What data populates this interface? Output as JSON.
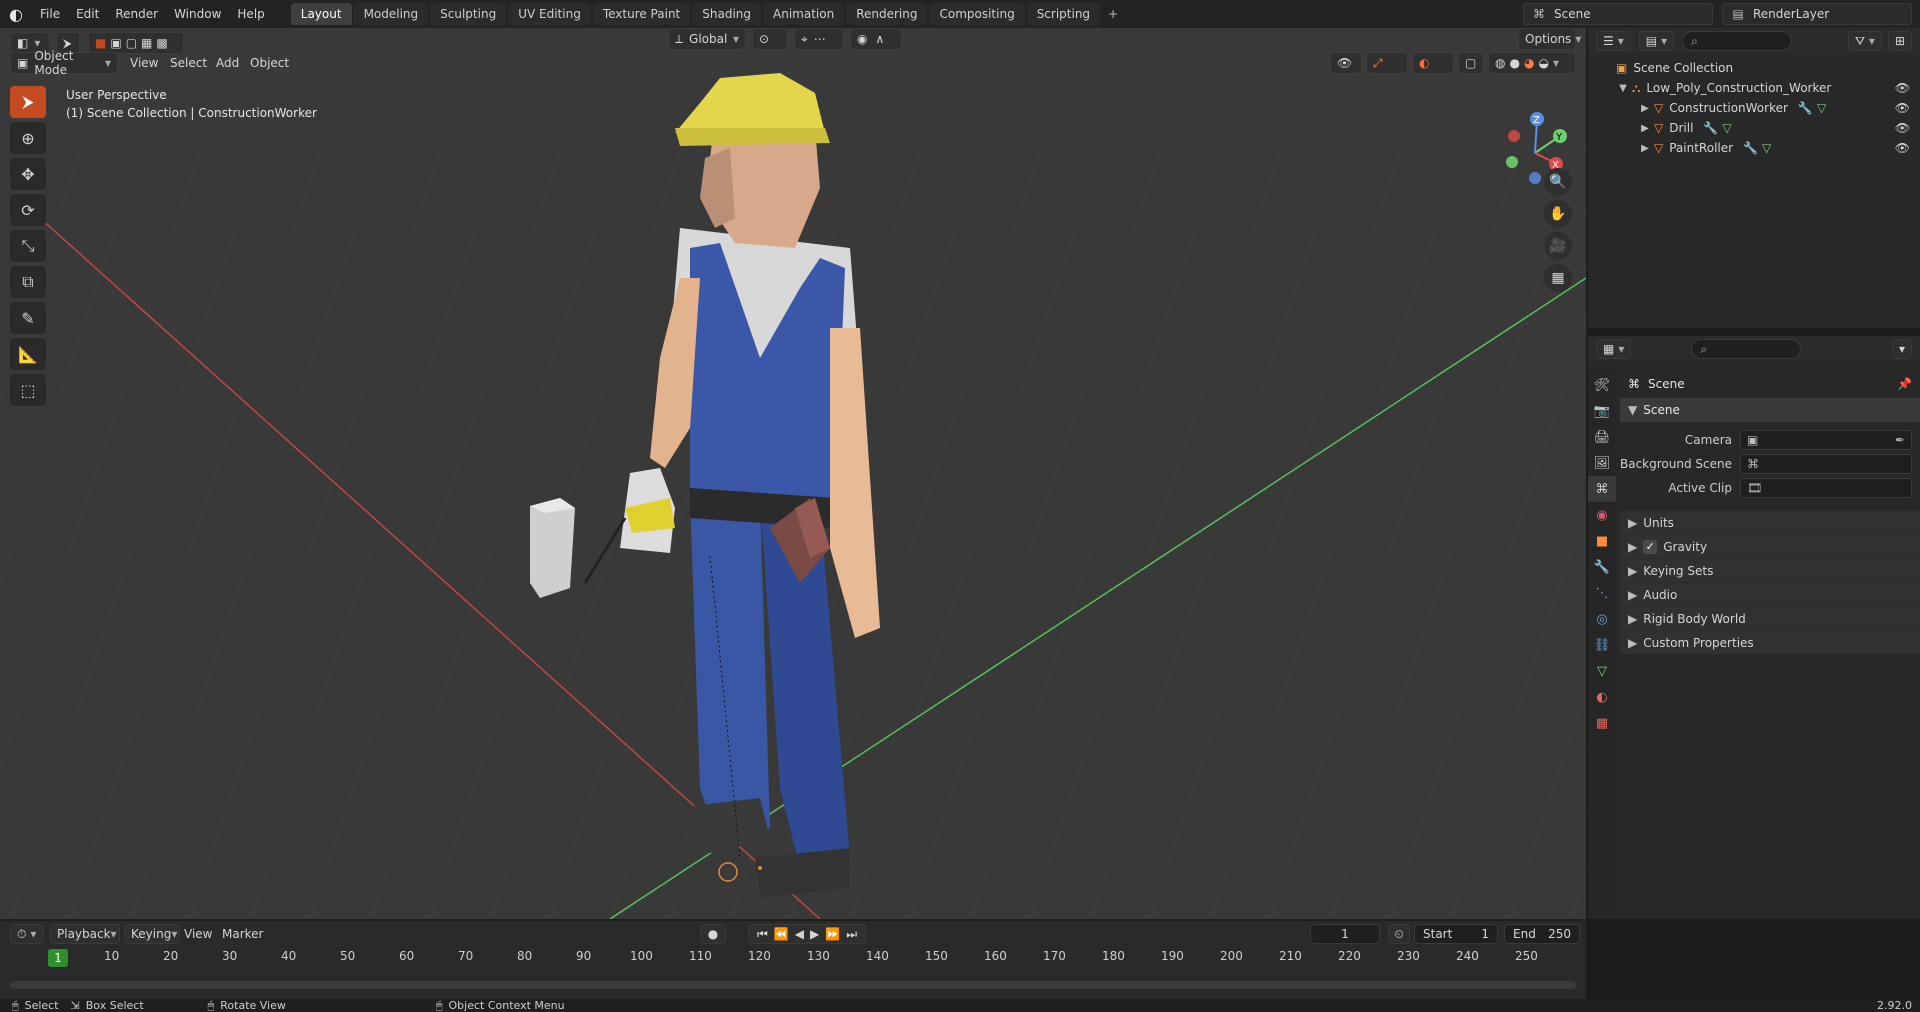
{
  "top_menu": [
    "File",
    "Edit",
    "Render",
    "Window",
    "Help"
  ],
  "workspace_tabs": [
    "Layout",
    "Modeling",
    "Sculpting",
    "UV Editing",
    "Texture Paint",
    "Shading",
    "Animation",
    "Rendering",
    "Compositing",
    "Scripting"
  ],
  "active_tab": "Layout",
  "tab_add": "+",
  "scene_selector": {
    "name": "Scene"
  },
  "view_layer": {
    "name": "RenderLayer"
  },
  "viewport": {
    "mode": "Object Mode",
    "menus": [
      "View",
      "Select",
      "Add",
      "Object"
    ],
    "transform_orientation": "Global",
    "options_label": "Options",
    "info_line1": "User Perspective",
    "info_line2": "(1) Scene Collection | ConstructionWorker",
    "gizmo_axes": {
      "z": "Z",
      "y": "Y",
      "x": "X"
    }
  },
  "outliner": {
    "search_placeholder": "",
    "root": "Scene Collection",
    "collection": "Low_Poly_Construction_Worker",
    "objects": [
      "ConstructionWorker",
      "Drill",
      "PaintRoller"
    ]
  },
  "properties": {
    "panel_title": "Scene",
    "section_scene": "Scene",
    "fields": [
      {
        "label": "Camera",
        "value": ""
      },
      {
        "label": "Background Scene",
        "value": ""
      },
      {
        "label": "Active Clip",
        "value": ""
      }
    ],
    "subsections": [
      "Units",
      "Gravity",
      "Keying Sets",
      "Audio",
      "Rigid Body World",
      "Custom Properties"
    ],
    "gravity_checked": true
  },
  "timeline": {
    "menus": [
      "Playback",
      "Keying",
      "View",
      "Marker"
    ],
    "current_frame": "1",
    "start_label": "Start",
    "start_value": "1",
    "end_label": "End",
    "end_value": "250",
    "ticks": [
      "10",
      "20",
      "30",
      "40",
      "50",
      "60",
      "70",
      "80",
      "90",
      "100",
      "110",
      "120",
      "130",
      "140",
      "150",
      "160",
      "170",
      "180",
      "190",
      "200",
      "210",
      "220",
      "230",
      "240",
      "250"
    ],
    "playhead_value": "1"
  },
  "statusbar": {
    "select": "Select",
    "box_select": "Box Select",
    "rotate_view": "Rotate View",
    "context_menu": "Object Context Menu",
    "version": "2.92.0"
  },
  "colors": {
    "accent_orange": "#c44a1f",
    "x_axis": "#e04a4a",
    "y_axis": "#6fcf6f",
    "z_axis": "#5a8fe8",
    "helmet": "#e7d64a",
    "overalls": "#3c5aa8",
    "shirt": "#dcdcdc",
    "skin": "#e0b08a"
  }
}
